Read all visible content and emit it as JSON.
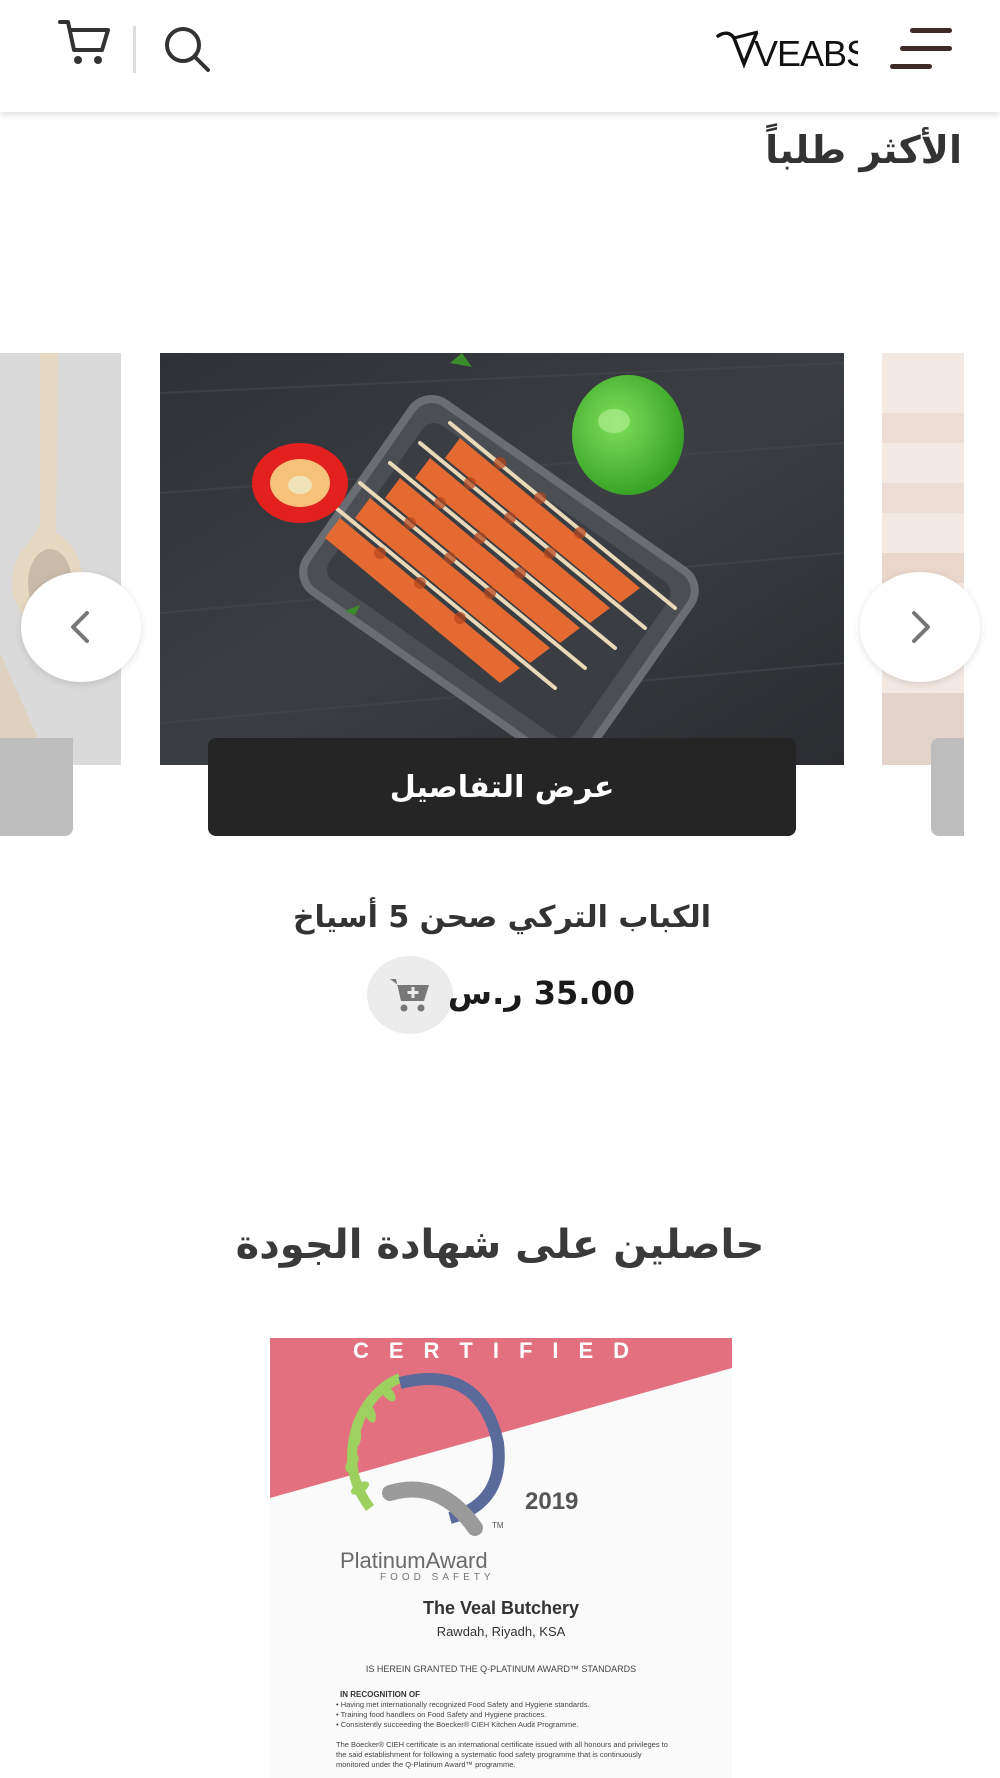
{
  "header": {
    "logo_text": "VEABS",
    "icons": [
      "cart-icon",
      "search-icon",
      "hamburger-menu-icon"
    ]
  },
  "most_requested": {
    "title": "الأكثر طلباً"
  },
  "product": {
    "details_label": "عرض التفاصيل",
    "name": "الكباب التركي صحن 5 أسياخ",
    "price": "35.00 ر.س",
    "image": "kebab-skewers-tray-image"
  },
  "quality": {
    "title": "حاصلين على شهادة الجودة"
  },
  "certificate": {
    "banner": "CERTIFIED",
    "year": "2019",
    "tm": "TM",
    "award": "PlatinumAward",
    "award_sub": "FOOD SAFETY",
    "company": "The Veal Butchery",
    "location": "Rawdah, Riyadh, KSA",
    "granted": "IS HEREIN GRANTED THE Q-PLATINUM AWARD™ STANDARDS",
    "recognition_heading": "IN RECOGNITION OF",
    "bullets": [
      "• Having met internationally recognized Food Safety and Hygiene standards.",
      "• Training food handlers on Food Safety and Hygiene practices.",
      "• Consistently succeeding the Boecker® CIEH Kitchen Audit Programme."
    ],
    "footer": "The Boecker® CIEH certificate is an international certificate issued with all honours and privileges to the said establishment for following a systematic food safety programme that is continuously monitored under the Q-Platinum Award™ programme."
  },
  "colors": {
    "accent_dark": "#252526",
    "menu_brown": "#3e2a26",
    "certificate_red": "#e2707f"
  }
}
